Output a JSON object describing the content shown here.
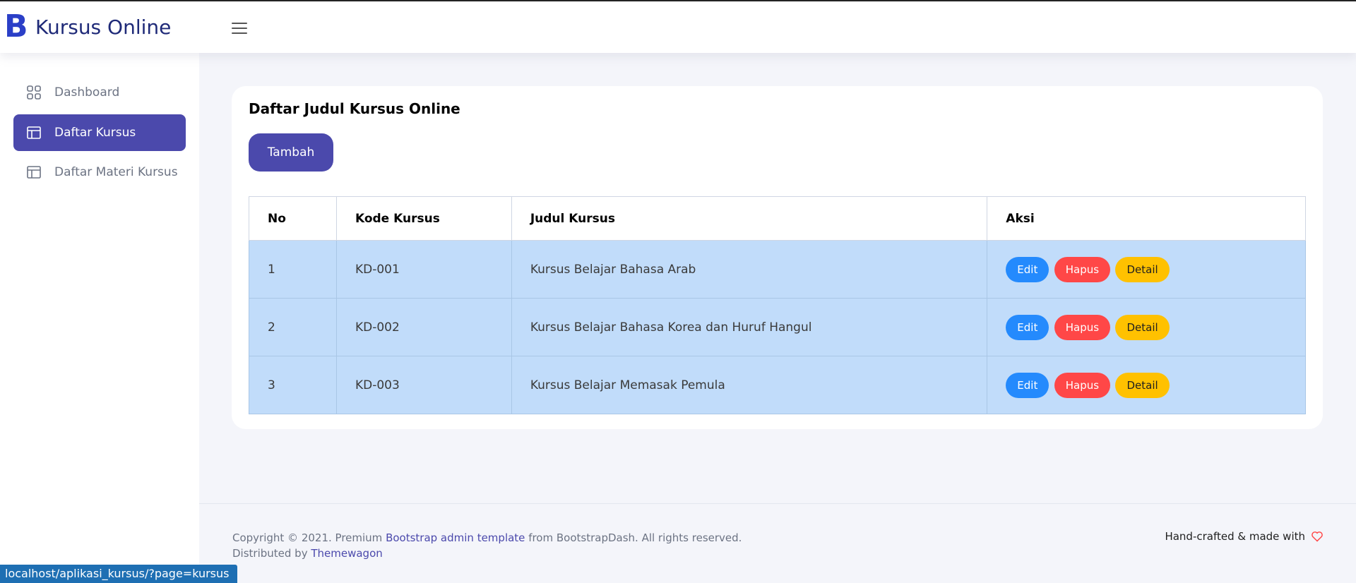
{
  "brand": {
    "logo_letter": "B",
    "name": "Kursus Online",
    "color": "#2b3fc7"
  },
  "sidebar": {
    "items": [
      {
        "label": "Dashboard",
        "icon": "grid-icon",
        "active": false
      },
      {
        "label": "Daftar Kursus",
        "icon": "layout-icon",
        "active": true
      },
      {
        "label": "Daftar Materi Kursus",
        "icon": "layout-icon",
        "active": false
      }
    ],
    "active_color": "#4b49ac"
  },
  "card": {
    "title": "Daftar Judul Kursus Online",
    "add_button": "Tambah"
  },
  "table": {
    "headers": [
      "No",
      "Kode Kursus",
      "Judul Kursus",
      "Aksi"
    ],
    "rows": [
      {
        "no": "1",
        "kode": "KD-001",
        "judul": "Kursus Belajar Bahasa Arab"
      },
      {
        "no": "2",
        "kode": "KD-002",
        "judul": "Kursus Belajar Bahasa Korea dan Huruf Hangul"
      },
      {
        "no": "3",
        "kode": "KD-003",
        "judul": "Kursus Belajar Memasak Pemula"
      }
    ],
    "actions": {
      "edit": "Edit",
      "hapus": "Hapus",
      "detail": "Detail"
    },
    "row_color": "#c1dcfa"
  },
  "footer": {
    "copyright_prefix": "Copyright © 2021. Premium ",
    "template_link": "Bootstrap admin template",
    "copyright_suffix": " from BootstrapDash. All rights reserved.",
    "distributed_prefix": "Distributed by ",
    "distributed_link": "Themewagon",
    "right_text": "Hand-crafted & made with",
    "right_icon": "heart-icon"
  },
  "status_bar": {
    "url": "localhost/aplikasi_kursus/?page=kursus"
  }
}
